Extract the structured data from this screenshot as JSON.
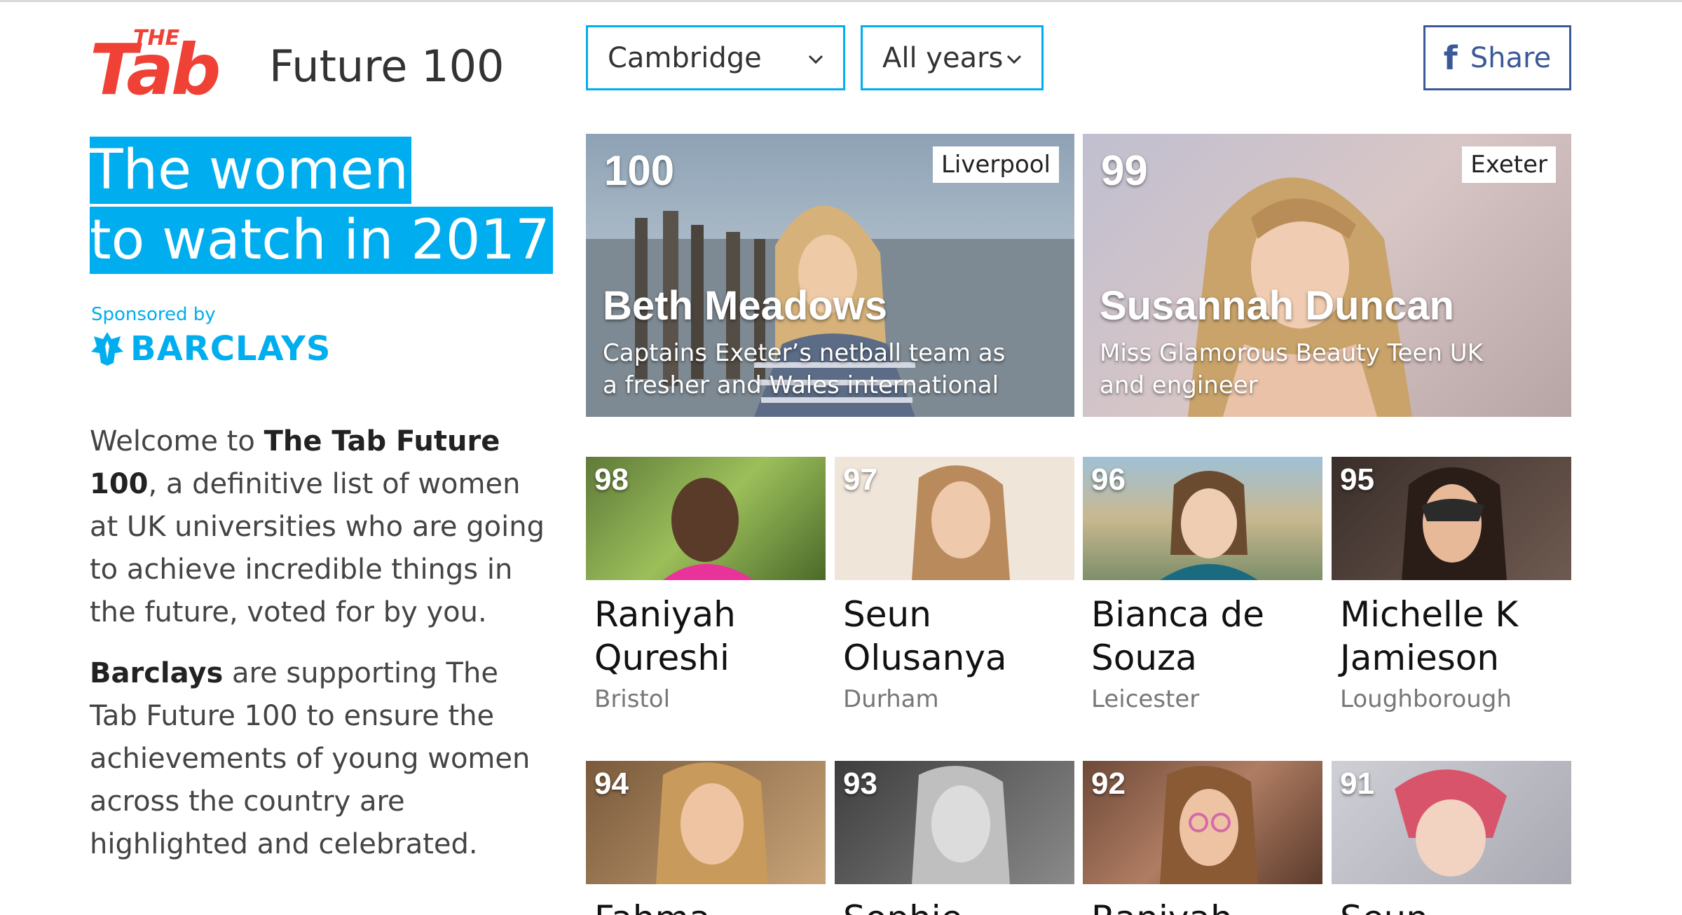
{
  "brand": {
    "logo_text": "The Tab",
    "title": "Future 100"
  },
  "headline": {
    "line1": "The women",
    "line2": "to watch in 2017"
  },
  "sponsor": {
    "label": "Sponsored by",
    "name": "BARCLAYS"
  },
  "intro": {
    "p1_pre": "Welcome to ",
    "p1_bold": "The Tab Future 100",
    "p1_post": ", a definitive list of women at UK universities who are going to achieve incredible things in the future, voted for by you.",
    "p2_bold": "Barclays",
    "p2_post": " are supporting The Tab Future 100 to ensure the achievements of young women across the country are highlighted and celebrated."
  },
  "filters": {
    "city": "Cambridge",
    "year": "All years"
  },
  "share": {
    "label": "Share",
    "icon": "facebook-icon"
  },
  "featured": [
    {
      "rank": "100",
      "university": "Liverpool",
      "name": "Beth Meadows",
      "description": "Captains Exeter’s netball team as a fresher and Wales international"
    },
    {
      "rank": "99",
      "university": "Exeter",
      "name": "Susannah Duncan",
      "description": "Miss Glamorous Beauty Teen UK and engineer"
    }
  ],
  "grid_row1": [
    {
      "rank": "98",
      "name": "Raniyah Qureshi",
      "university": "Bristol"
    },
    {
      "rank": "97",
      "name": "Seun Olusanya",
      "university": "Durham"
    },
    {
      "rank": "96",
      "name": "Bianca de Souza",
      "university": "Leicester"
    },
    {
      "rank": "95",
      "name": "Michelle K Jamieson",
      "university": "Loughborough"
    }
  ],
  "grid_row2": [
    {
      "rank": "94",
      "name": "Fahma",
      "university": ""
    },
    {
      "rank": "93",
      "name": "Sophie",
      "university": ""
    },
    {
      "rank": "92",
      "name": "Raniyah",
      "university": ""
    },
    {
      "rank": "91",
      "name": "Seun",
      "university": ""
    }
  ],
  "colors": {
    "accent": "#00aeef",
    "logo": "#ef4135",
    "facebook": "#3b5998"
  }
}
